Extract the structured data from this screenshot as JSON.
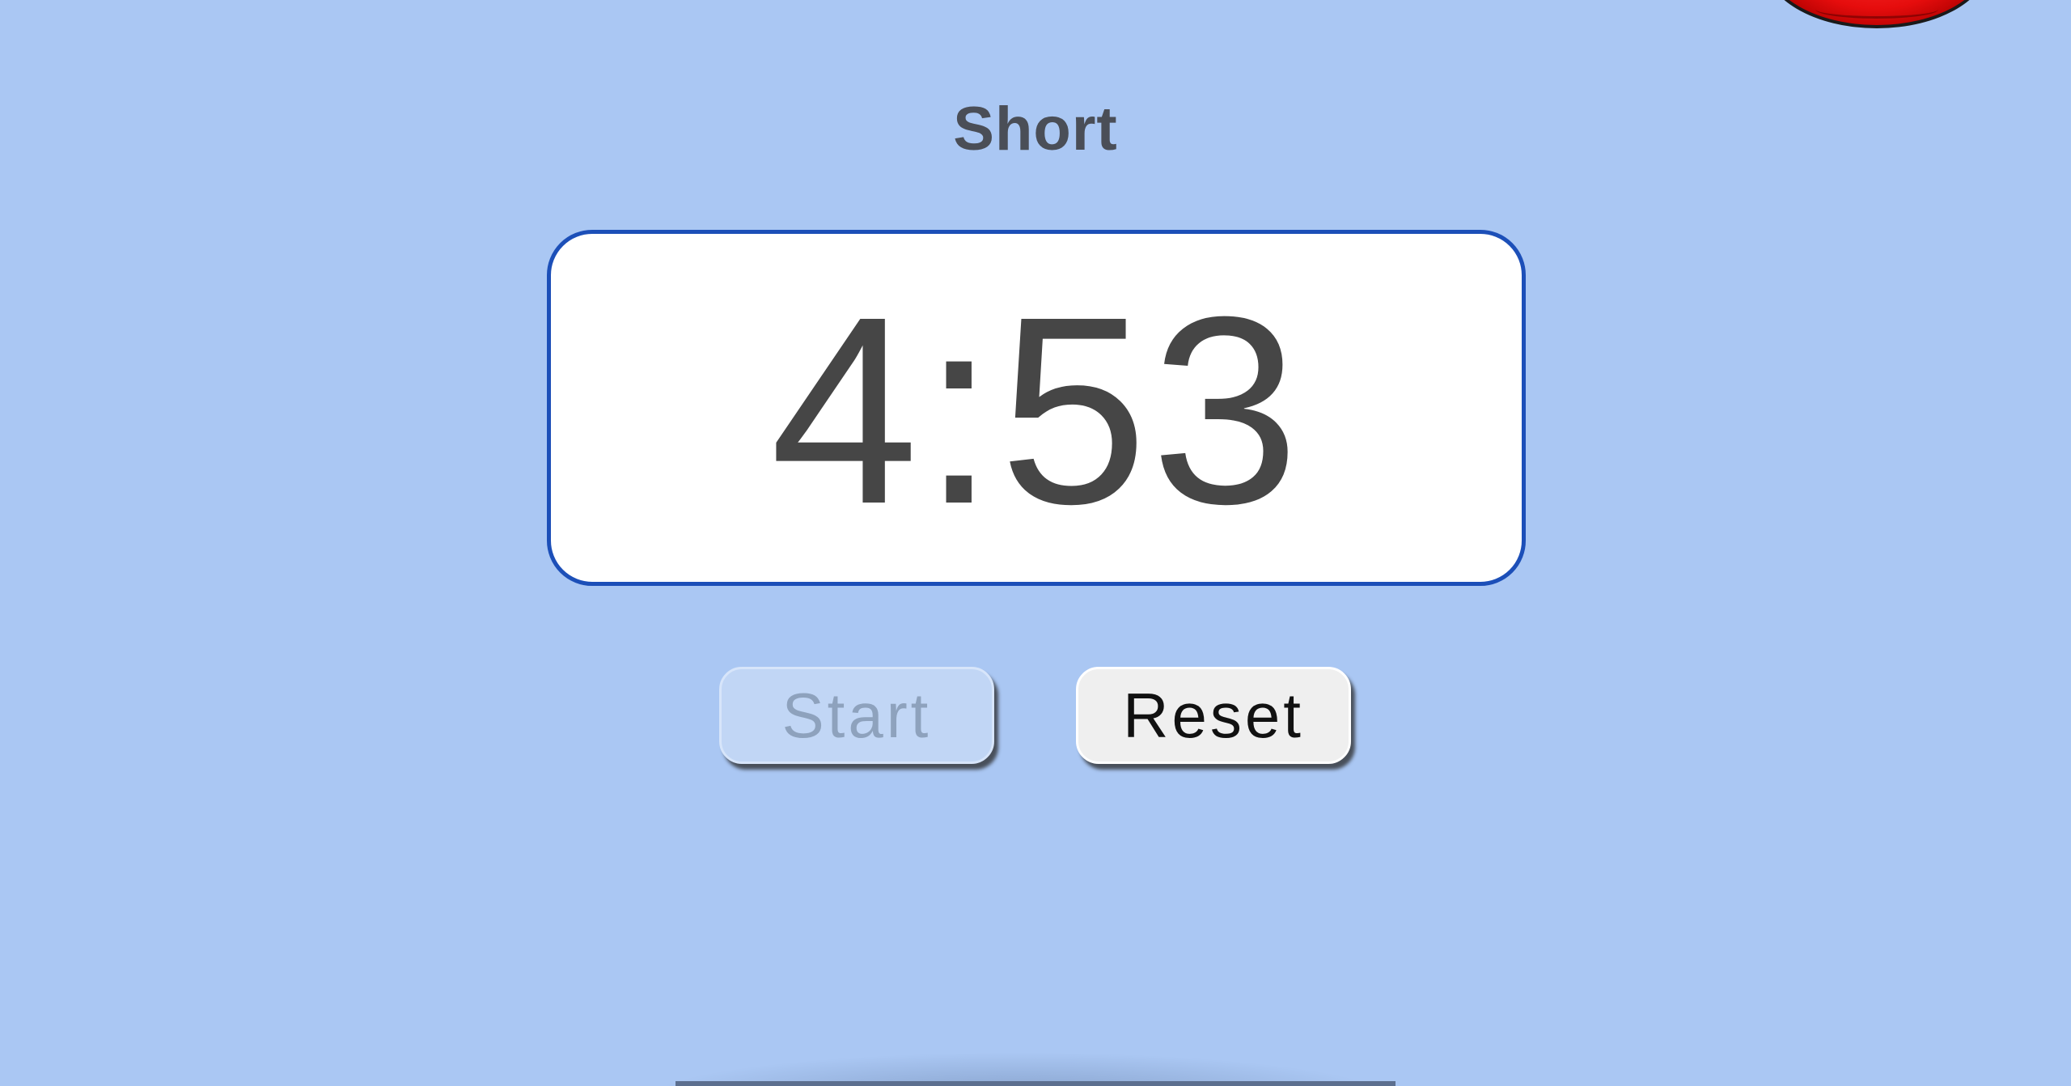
{
  "timer": {
    "mode_label": "Short",
    "time_remaining": "4:53"
  },
  "controls": {
    "start_label": "Start",
    "start_enabled": false,
    "reset_label": "Reset"
  },
  "colors": {
    "background": "#aac7f3",
    "display_border": "#1c4fb8",
    "display_bg": "#ffffff",
    "timer_text": "#464646",
    "accent_blob": "#e60d0d"
  }
}
